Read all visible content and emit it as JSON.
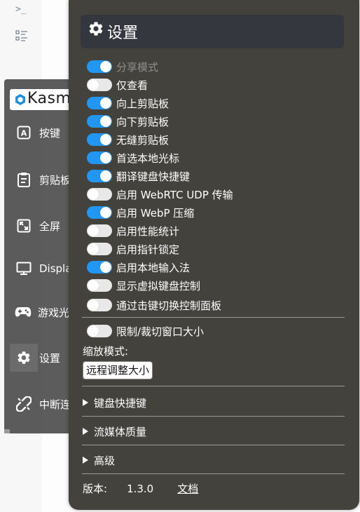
{
  "background": {
    "terminal_glyph": ">_"
  },
  "sidebar": {
    "logo_text": "Kasm VNC",
    "items": [
      {
        "label": "按键",
        "icon": "keyboard-a-icon"
      },
      {
        "label": "剪贴板",
        "icon": "clipboard-icon"
      },
      {
        "label": "全屏",
        "icon": "fullscreen-icon"
      },
      {
        "label": "Displays",
        "icon": "display-icon"
      },
      {
        "label": "游戏光标模式",
        "icon": "gamepad-icon"
      },
      {
        "label": "设置",
        "icon": "gear-icon",
        "active": true
      },
      {
        "label": "中断连接",
        "icon": "disconnect-icon"
      }
    ]
  },
  "settings": {
    "title": "设置",
    "options": [
      {
        "label": "分享模式",
        "on": true,
        "disabled": true
      },
      {
        "label": "仅查看",
        "on": false
      },
      {
        "label": "向上剪贴板",
        "on": true
      },
      {
        "label": "向下剪贴板",
        "on": true
      },
      {
        "label": "无缝剪贴板",
        "on": true
      },
      {
        "label": "首选本地光标",
        "on": true
      },
      {
        "label": "翻译键盘快捷键",
        "on": true
      },
      {
        "label": "启用 WebRTC UDP 传输",
        "on": false
      },
      {
        "label": "启用 WebP 压缩",
        "on": true
      },
      {
        "label": "启用性能统计",
        "on": false
      },
      {
        "label": "启用指针锁定",
        "on": false
      },
      {
        "label": "启用本地输入法",
        "on": true
      },
      {
        "label": "显示虚拟键盘控制",
        "on": false
      },
      {
        "label": "通过击键切换控制面板",
        "on": false
      }
    ],
    "clip_option": {
      "label": "限制/裁切窗口大小",
      "on": false
    },
    "scale_mode_label": "缩放模式:",
    "scale_mode_value": "远程调整大小",
    "sections": [
      "键盘快捷键",
      "流媒体质量",
      "高级"
    ],
    "version_label": "版本:",
    "version_value": "1.3.0",
    "docs_link": "文档"
  }
}
